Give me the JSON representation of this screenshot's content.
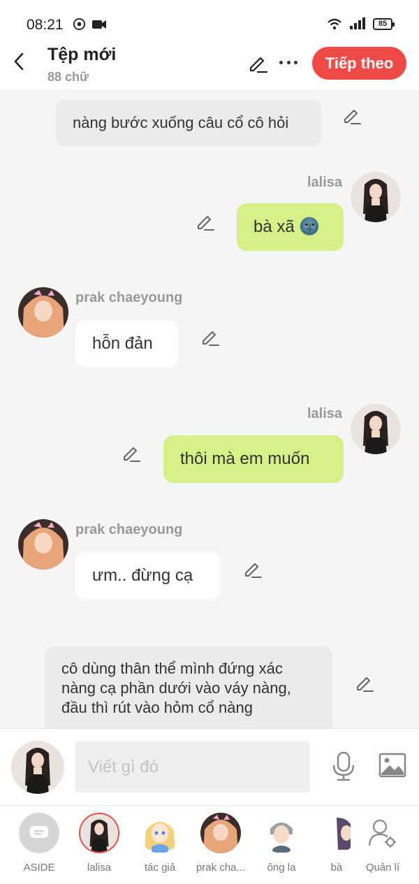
{
  "status_bar": {
    "time": "08:21",
    "battery": "85"
  },
  "header": {
    "title": "Tệp mới",
    "word_count": "88 chữ",
    "next_label": "Tiếp theo"
  },
  "messages": [
    {
      "type": "narration",
      "text": "nàng bước xuống câu cổ cô hỏi"
    },
    {
      "type": "right",
      "name": "lalisa",
      "text": "bà xã 🌚"
    },
    {
      "type": "left",
      "name": "prak chaeyoung",
      "text": "hỗn đản"
    },
    {
      "type": "right",
      "name": "lalisa",
      "text": "thôi mà em muốn"
    },
    {
      "type": "left",
      "name": "prak chaeyoung",
      "text": "ưm.. đừng cạ"
    },
    {
      "type": "narration",
      "text": "cô dùng thân thể mình đứng xác nàng cạ phần dưới vào váy nàng, đầu thì rút vào hỏm cổ nàng"
    }
  ],
  "composer": {
    "placeholder": "Viết gì đó"
  },
  "characters": [
    {
      "label": "ASIDE"
    },
    {
      "label": "lalisa"
    },
    {
      "label": "tác giả"
    },
    {
      "label": "prak cha..."
    },
    {
      "label": "ông la"
    },
    {
      "label": "bà"
    },
    {
      "label": "Quản lí"
    }
  ],
  "colors": {
    "accent": "#f04a48",
    "green_bubble": "#d4f086",
    "narration_bubble": "#ebebeb"
  }
}
